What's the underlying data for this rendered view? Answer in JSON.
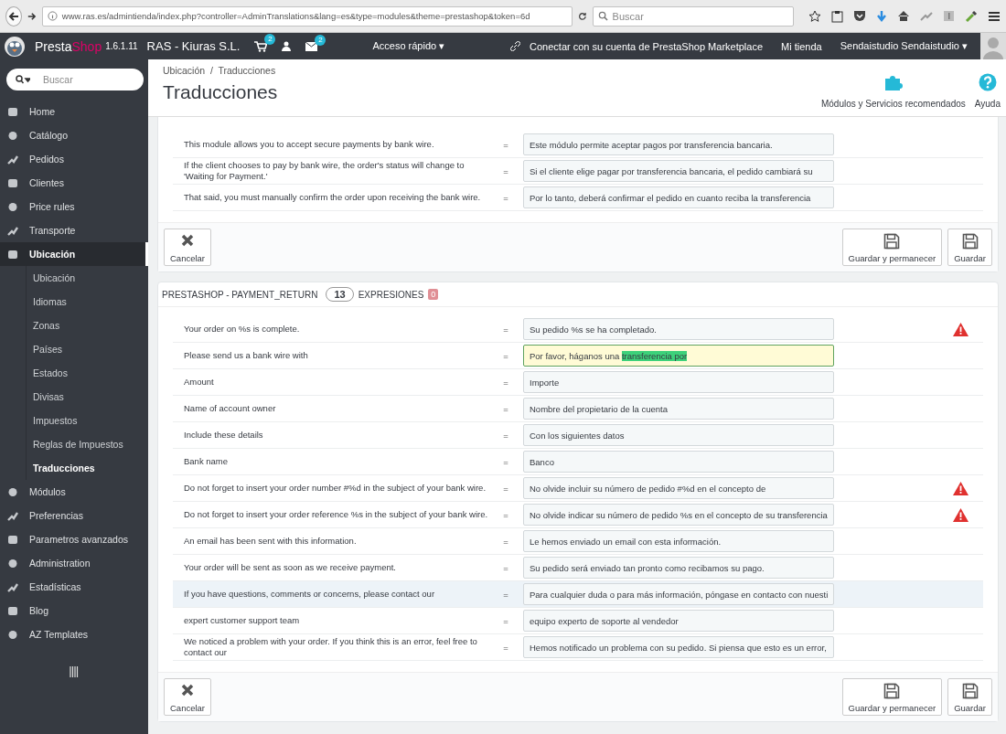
{
  "browser": {
    "url": "www.ras.es/admintienda/index.php?controller=AdminTranslations&lang=es&type=modules&theme=prestashop&token=6d",
    "search": {
      "placeholder": "Buscar"
    }
  },
  "topbar": {
    "brand_a": "Presta",
    "brand_b": "Shop",
    "version": "1.6.1.11",
    "shop": "RAS - Kiuras S.L.",
    "cart_badge": "2",
    "mail_badge": "2",
    "quick_access": "Acceso rápido ▾",
    "marketplace": "Conectar con su cuenta de PrestaShop Marketplace",
    "my_shop": "Mi tienda",
    "user": "Sendaistudio Sendaistudio ▾"
  },
  "sidebar": {
    "search": {
      "placeholder": "Buscar"
    },
    "items": [
      {
        "label": "Home",
        "selected": false
      },
      {
        "label": "Catálogo",
        "selected": false
      },
      {
        "label": "Pedidos",
        "selected": false
      },
      {
        "label": "Clientes",
        "selected": false
      },
      {
        "label": "Price rules",
        "selected": false
      },
      {
        "label": "Transporte",
        "selected": false
      },
      {
        "label": "Ubicación",
        "selected": true,
        "children": [
          {
            "label": "Ubicación",
            "selected": false
          },
          {
            "label": "Idiomas",
            "selected": false
          },
          {
            "label": "Zonas",
            "selected": false
          },
          {
            "label": "Países",
            "selected": false
          },
          {
            "label": "Estados",
            "selected": false
          },
          {
            "label": "Divisas",
            "selected": false
          },
          {
            "label": "Impuestos",
            "selected": false
          },
          {
            "label": "Reglas de Impuestos",
            "selected": false
          },
          {
            "label": "Traducciones",
            "selected": true
          }
        ]
      },
      {
        "label": "Módulos",
        "selected": false
      },
      {
        "label": "Preferencias",
        "selected": false
      },
      {
        "label": "Parametros avanzados",
        "selected": false
      },
      {
        "label": "Administration",
        "selected": false
      },
      {
        "label": "Estadísticas",
        "selected": false
      },
      {
        "label": "Blog",
        "selected": false
      },
      {
        "label": "AZ Templates",
        "selected": false
      }
    ]
  },
  "header": {
    "breadcrumb": "Ubicación  /  Traducciones",
    "title": "Traducciones",
    "actions": [
      "Módulos y Servicios recomendados",
      "Ayuda"
    ]
  },
  "panels": [
    {
      "rows": [
        {
          "source": "This module allows you to accept secure payments by bank wire.",
          "sign": "=",
          "value": "Este módulo permite aceptar pagos por transferencia bancaria.",
          "warning": false,
          "focused": false,
          "hovered": false
        },
        {
          "source": "If the client chooses to pay by bank wire, the order's status will change to 'Waiting for Payment.'",
          "sign": "=",
          "value": "Si el cliente elige pagar por transferencia bancaria, el pedido cambiará su",
          "warning": false,
          "focused": false,
          "hovered": false
        },
        {
          "source": "That said, you must manually confirm the order upon receiving the bank wire.",
          "sign": "=",
          "value": "Por lo tanto, deberá confirmar el pedido en cuanto reciba la transferencia",
          "warning": false,
          "focused": false,
          "hovered": false
        }
      ],
      "buttons": [
        "Cancelar",
        "Guardar y permanecer",
        "Guardar"
      ]
    },
    {
      "heading": "PRESTASHOP - PAYMENT_RETURN",
      "count": "13",
      "count_label": "EXPRESIONES",
      "missing": "0",
      "rows": [
        {
          "source": "Your order on %s is complete.",
          "sign": "=",
          "value": "Su pedido %s se ha completado.",
          "warning": true,
          "focused": false,
          "hovered": false
        },
        {
          "source": "Please send us a bank wire with",
          "sign": "=",
          "value": "Por favor, háganos una ",
          "selection": "transferencia por",
          "warning": false,
          "focused": true,
          "hovered": false
        },
        {
          "source": "Amount",
          "sign": "=",
          "value": "Importe",
          "warning": false,
          "focused": false,
          "hovered": false
        },
        {
          "source": "Name of account owner",
          "sign": "=",
          "value": "Nombre del propietario de la cuenta",
          "warning": false,
          "focused": false,
          "hovered": false
        },
        {
          "source": "Include these details",
          "sign": "=",
          "value": "Con los siguientes datos",
          "warning": false,
          "focused": false,
          "hovered": false
        },
        {
          "source": "Bank name",
          "sign": "=",
          "value": "Banco",
          "warning": false,
          "focused": false,
          "hovered": false
        },
        {
          "source": "Do not forget to insert your order number #%d in the subject of your bank wire.",
          "sign": "=",
          "value": "No olvide incluir su número de pedido #%d en el concepto de",
          "warning": true,
          "focused": false,
          "hovered": false
        },
        {
          "source": "Do not forget to insert your order reference %s in the subject of your bank wire.",
          "sign": "=",
          "value": "No olvide indicar su número de pedido %s en el concepto de su transferencia",
          "warning": true,
          "focused": false,
          "hovered": false
        },
        {
          "source": "An email has been sent with this information.",
          "sign": "=",
          "value": "Le hemos enviado un email con esta información.",
          "warning": false,
          "focused": false,
          "hovered": false
        },
        {
          "source": "Your order will be sent as soon as we receive payment.",
          "sign": "=",
          "value": "Su pedido será enviado tan pronto como recibamos su pago.",
          "warning": false,
          "focused": false,
          "hovered": false
        },
        {
          "source": "If you have questions, comments or concerns, please contact our",
          "sign": "=",
          "value": "Para cualquier duda o para más información, póngase en contacto con nuesti",
          "warning": false,
          "focused": false,
          "hovered": true
        },
        {
          "source": "expert customer support team",
          "sign": "=",
          "value": "equipo experto de soporte al vendedor",
          "warning": false,
          "focused": false,
          "hovered": false
        },
        {
          "source": "We noticed a problem with your order. If you think this is an error, feel free to contact our",
          "sign": "=",
          "value": "Hemos notificado un problema con su pedido. Si piensa que esto es un error,",
          "warning": false,
          "focused": false,
          "hovered": false
        }
      ],
      "buttons": [
        "Cancelar",
        "Guardar y permanecer",
        "Guardar"
      ]
    }
  ]
}
